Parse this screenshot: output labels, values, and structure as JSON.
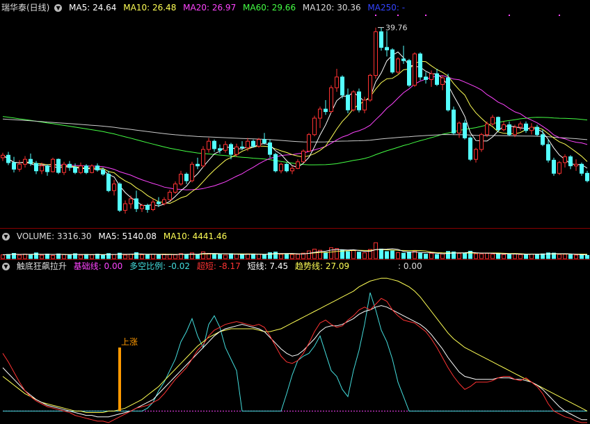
{
  "main_panel": {
    "title": "瑞华泰(日线)",
    "indicators": [
      {
        "label": "MA5: 24.64",
        "color": "#ffffff"
      },
      {
        "label": "MA10: 26.48",
        "color": "#ffff55"
      },
      {
        "label": "MA20: 26.97",
        "color": "#ff44ff"
      },
      {
        "label": "MA60: 29.66",
        "color": "#44ff44"
      },
      {
        "label": "MA120: 30.36",
        "color": "#dddddd"
      },
      {
        "label": "MA250: -",
        "color": "#3344ff"
      }
    ],
    "high_annotation": "39.76"
  },
  "volume_panel": {
    "indicators": [
      {
        "label": "VOLUME: 3316.30",
        "color": "#dddddd"
      },
      {
        "label": "MA5: 5140.08",
        "color": "#ffffff"
      },
      {
        "label": "MA10: 4441.46",
        "color": "#ffff55"
      }
    ]
  },
  "indicator_panel": {
    "title": "触底狂飙拉升",
    "indicators": [
      {
        "label": "基础线: 0.00",
        "color": "#ff44ff"
      },
      {
        "label": "多空比例: -0.02",
        "color": "#44dddd"
      },
      {
        "label": "超短: -8.17",
        "color": "#ff3333"
      },
      {
        "label": "短线: 7.45",
        "color": "#ffffff"
      },
      {
        "label": "趋势线: 27.09",
        "color": "#ffff55"
      },
      {
        "label": ": 0.00",
        "color": "#dddddd"
      }
    ],
    "signal_label": "上涨"
  },
  "colors": {
    "up": "#ff3232",
    "down": "#54ffff",
    "signal": "#ff9900",
    "ma120": "#cccccc"
  },
  "chart_data": {
    "type": "candlestick",
    "price_range": [
      16.5,
      41.5
    ],
    "high_marker": 39.76,
    "candles": [
      [
        24.2,
        24.8,
        23.8,
        24.5
      ],
      [
        24.5,
        24.9,
        23.3,
        23.6
      ],
      [
        23.6,
        24.3,
        22.4,
        22.8
      ],
      [
        22.8,
        23.9,
        22.5,
        23.4
      ],
      [
        23.4,
        24.4,
        23.0,
        24.0
      ],
      [
        24.0,
        24.7,
        23.2,
        23.5
      ],
      [
        23.5,
        23.8,
        22.2,
        22.6
      ],
      [
        22.6,
        23.6,
        22.2,
        23.2
      ],
      [
        23.2,
        23.4,
        22.0,
        22.5
      ],
      [
        22.5,
        24.2,
        22.4,
        24.0
      ],
      [
        24.0,
        24.1,
        22.2,
        22.4
      ],
      [
        22.4,
        23.7,
        22.1,
        23.4
      ],
      [
        23.4,
        23.8,
        22.6,
        23.0
      ],
      [
        23.0,
        23.5,
        22.2,
        22.4
      ],
      [
        22.4,
        23.6,
        22.2,
        23.2
      ],
      [
        23.2,
        23.4,
        22.2,
        22.4
      ],
      [
        22.4,
        23.4,
        22.3,
        23.2
      ],
      [
        23.2,
        23.5,
        22.5,
        22.7
      ],
      [
        22.7,
        23.0,
        22.0,
        22.2
      ],
      [
        22.2,
        22.6,
        20.0,
        20.2
      ],
      [
        20.2,
        21.5,
        19.6,
        21.0
      ],
      [
        21.0,
        21.2,
        17.6,
        17.8
      ],
      [
        17.8,
        19.0,
        17.4,
        18.6
      ],
      [
        18.6,
        19.6,
        18.0,
        19.2
      ],
      [
        19.2,
        20.2,
        17.6,
        18.0
      ],
      [
        18.0,
        18.6,
        17.6,
        18.4
      ],
      [
        18.4,
        18.6,
        17.5,
        17.9
      ],
      [
        17.9,
        19.2,
        17.7,
        18.8
      ],
      [
        18.8,
        19.4,
        18.2,
        18.6
      ],
      [
        18.6,
        19.4,
        18.4,
        19.1
      ],
      [
        19.1,
        20.3,
        19.0,
        20.0
      ],
      [
        20.0,
        21.3,
        19.8,
        21.0
      ],
      [
        21.0,
        22.6,
        20.8,
        22.2
      ],
      [
        22.2,
        22.4,
        21.0,
        21.4
      ],
      [
        21.4,
        23.7,
        21.2,
        23.4
      ],
      [
        23.4,
        24.2,
        22.8,
        23.2
      ],
      [
        23.2,
        25.6,
        23.0,
        25.2
      ],
      [
        25.2,
        26.6,
        24.8,
        26.2
      ],
      [
        26.2,
        26.4,
        24.9,
        25.3
      ],
      [
        25.3,
        25.8,
        24.7,
        25.1
      ],
      [
        25.1,
        26.2,
        24.8,
        25.8
      ],
      [
        25.8,
        26.0,
        24.0,
        24.6
      ],
      [
        24.6,
        25.9,
        24.3,
        25.5
      ],
      [
        25.5,
        26.2,
        25.1,
        25.4
      ],
      [
        25.4,
        26.6,
        25.0,
        26.2
      ],
      [
        26.2,
        26.4,
        25.4,
        25.6
      ],
      [
        25.6,
        26.6,
        25.4,
        26.4
      ],
      [
        26.4,
        27.2,
        25.8,
        26.0
      ],
      [
        26.0,
        26.4,
        24.2,
        24.6
      ],
      [
        24.6,
        24.8,
        22.4,
        22.6
      ],
      [
        22.6,
        23.6,
        22.3,
        23.4
      ],
      [
        23.4,
        23.6,
        22.4,
        22.6
      ],
      [
        22.6,
        23.2,
        22.2,
        22.9
      ],
      [
        22.9,
        24.0,
        22.8,
        23.7
      ],
      [
        23.7,
        25.2,
        23.6,
        25.0
      ],
      [
        25.0,
        27.2,
        24.9,
        27.0
      ],
      [
        27.0,
        29.3,
        26.8,
        29.0
      ],
      [
        29.0,
        30.4,
        27.8,
        30.1
      ],
      [
        30.1,
        31.2,
        29.4,
        29.8
      ],
      [
        29.8,
        33.0,
        29.6,
        32.7
      ],
      [
        32.7,
        35.0,
        32.2,
        34.0
      ],
      [
        34.0,
        34.2,
        31.4,
        31.8
      ],
      [
        31.8,
        32.6,
        29.6,
        30.0
      ],
      [
        30.0,
        32.4,
        29.8,
        32.2
      ],
      [
        32.2,
        32.6,
        29.7,
        30.0
      ],
      [
        30.0,
        31.6,
        29.6,
        31.2
      ],
      [
        31.2,
        34.4,
        31.0,
        34.2
      ],
      [
        34.2,
        40.0,
        33.8,
        39.5
      ],
      [
        39.5,
        40.0,
        37.2,
        37.6
      ],
      [
        37.6,
        39.6,
        36.5,
        37.3
      ],
      [
        37.3,
        37.5,
        34.4,
        34.6
      ],
      [
        34.6,
        36.4,
        34.4,
        36.2
      ],
      [
        36.2,
        37.8,
        35.6,
        36.0
      ],
      [
        36.0,
        36.2,
        32.8,
        33.0
      ],
      [
        33.0,
        37.0,
        32.8,
        36.8
      ],
      [
        36.8,
        37.0,
        33.6,
        34.0
      ],
      [
        34.0,
        34.6,
        33.2,
        33.7
      ],
      [
        33.7,
        34.8,
        32.8,
        34.4
      ],
      [
        34.4,
        35.0,
        32.9,
        33.1
      ],
      [
        33.1,
        34.2,
        32.4,
        33.9
      ],
      [
        33.9,
        34.4,
        29.8,
        30.0
      ],
      [
        30.0,
        30.4,
        27.0,
        27.2
      ],
      [
        27.2,
        28.6,
        26.6,
        28.4
      ],
      [
        28.4,
        28.8,
        26.4,
        26.6
      ],
      [
        26.6,
        26.8,
        23.8,
        24.0
      ],
      [
        24.0,
        25.4,
        23.6,
        25.2
      ],
      [
        25.2,
        27.2,
        24.9,
        27.0
      ],
      [
        27.0,
        28.6,
        26.7,
        28.3
      ],
      [
        28.3,
        29.4,
        28.1,
        29.1
      ],
      [
        29.1,
        29.2,
        27.3,
        27.6
      ],
      [
        27.6,
        28.6,
        27.4,
        28.2
      ],
      [
        28.2,
        28.6,
        26.8,
        27.0
      ],
      [
        27.0,
        28.2,
        26.7,
        27.9
      ],
      [
        27.9,
        28.6,
        27.5,
        28.3
      ],
      [
        28.3,
        28.6,
        27.2,
        27.5
      ],
      [
        27.5,
        28.4,
        27.0,
        27.9
      ],
      [
        27.9,
        28.2,
        26.8,
        27.0
      ],
      [
        27.0,
        27.6,
        25.6,
        25.8
      ],
      [
        25.8,
        26.4,
        23.6,
        23.9
      ],
      [
        23.9,
        24.2,
        22.0,
        22.3
      ],
      [
        22.3,
        23.8,
        22.1,
        23.6
      ],
      [
        23.6,
        24.6,
        23.0,
        24.3
      ],
      [
        24.3,
        24.5,
        22.8,
        23.2
      ],
      [
        23.2,
        24.0,
        22.6,
        23.4
      ],
      [
        23.4,
        23.6,
        22.0,
        22.3
      ],
      [
        22.3,
        22.6,
        21.2,
        21.4
      ]
    ],
    "volume_range": [
      0,
      18000
    ],
    "volume": [
      3900,
      4300,
      5400,
      3600,
      4600,
      3900,
      5900,
      3500,
      4700,
      3300,
      4800,
      4200,
      3700,
      5100,
      3600,
      4400,
      3900,
      4600,
      3400,
      5200,
      4100,
      5600,
      3700,
      4500,
      6200,
      3900,
      3600,
      4400,
      3600,
      4700,
      4400,
      3900,
      5200,
      4100,
      5900,
      3700,
      6900,
      5400,
      4900,
      4500,
      3600,
      5100,
      4600,
      3900,
      4900,
      4300,
      4700,
      3900,
      6100,
      6800,
      4400,
      5100,
      4200,
      4400,
      5600,
      7900,
      9800,
      8600,
      6400,
      11200,
      10400,
      9100,
      7200,
      8300,
      6700,
      6000,
      9400,
      16400,
      9900,
      7300,
      7900,
      6100,
      5600,
      6900,
      7900,
      5600,
      4600,
      5300,
      4300,
      4900,
      7400,
      6900,
      5300,
      5700,
      7600,
      4900,
      4900,
      5300,
      4600,
      5300,
      4200,
      4700,
      4600,
      4100,
      4400,
      4700,
      4500,
      4900,
      5900,
      5700,
      4300,
      4500,
      3900,
      3600,
      3800,
      3300
    ],
    "indicator_range": [
      -8,
      95
    ],
    "signal_index": 21,
    "signal_value": 44,
    "series": {
      "超短": [
        40,
        34,
        27,
        20,
        14,
        10,
        7,
        5,
        3,
        2,
        1,
        0,
        -1,
        -3,
        -4,
        -5,
        -6,
        -7,
        -7,
        -8,
        -6,
        -4,
        -2,
        0,
        2,
        3,
        4,
        6,
        8,
        12,
        17,
        22,
        26,
        30,
        36,
        42,
        46,
        52,
        56,
        58,
        60,
        61,
        62,
        61,
        60,
        59,
        60,
        58,
        52,
        45,
        38,
        34,
        33,
        35,
        40,
        47,
        55,
        61,
        63,
        60,
        58,
        59,
        63,
        66,
        70,
        72,
        70,
        74,
        78,
        76,
        70,
        66,
        63,
        62,
        61,
        58,
        55,
        50,
        44,
        37,
        30,
        24,
        19,
        15,
        17,
        20,
        20,
        20,
        21,
        23,
        24,
        24,
        22,
        21,
        23,
        20,
        17,
        12,
        5,
        0,
        -2,
        -4,
        -5,
        -7,
        -8,
        -8
      ],
      "短线": [
        30,
        26,
        22,
        18,
        14,
        11,
        8,
        6,
        4,
        3,
        2,
        1,
        0,
        -1,
        -2,
        -3,
        -3,
        -4,
        -4,
        -4,
        -3,
        -2,
        -1,
        0,
        2,
        4,
        6,
        8,
        12,
        16,
        20,
        24,
        28,
        32,
        36,
        40,
        44,
        48,
        52,
        55,
        57,
        58,
        59,
        60,
        59,
        58,
        57,
        55,
        51,
        47,
        43,
        40,
        38,
        39,
        42,
        46,
        50,
        55,
        58,
        59,
        59,
        60,
        62,
        64,
        67,
        69,
        70,
        72,
        73,
        72,
        70,
        68,
        66,
        64,
        62,
        60,
        57,
        53,
        48,
        43,
        37,
        32,
        27,
        24,
        23,
        22,
        22,
        22,
        22,
        23,
        23,
        23,
        22,
        22,
        21,
        20,
        18,
        15,
        11,
        7,
        3,
        0,
        -2,
        -4,
        -6,
        -6
      ],
      "趋势线": [
        24,
        21,
        18,
        15,
        12,
        10,
        8,
        6,
        5,
        4,
        3,
        2,
        1,
        0,
        0,
        -1,
        -1,
        -1,
        -1,
        0,
        0,
        1,
        2,
        4,
        6,
        8,
        11,
        14,
        17,
        21,
        25,
        29,
        33,
        37,
        41,
        45,
        48,
        51,
        53,
        55,
        56,
        57,
        57,
        57,
        57,
        57,
        56,
        55,
        55,
        56,
        57,
        59,
        61,
        63,
        65,
        67,
        69,
        71,
        73,
        75,
        77,
        79,
        81,
        83,
        86,
        88,
        90,
        91,
        92,
        92,
        91,
        90,
        88,
        86,
        83,
        79,
        74,
        69,
        64,
        59,
        54,
        50,
        47,
        44,
        42,
        40,
        38,
        36,
        34,
        32,
        30,
        28,
        26,
        24,
        22,
        20,
        18,
        16,
        14,
        12,
        10,
        8,
        6,
        4,
        2,
        0
      ],
      "多空比例": [
        0,
        0,
        0,
        0,
        0,
        0,
        0,
        0,
        0,
        0,
        0,
        0,
        0,
        0,
        0,
        0,
        0,
        0,
        0,
        0,
        0,
        0,
        0,
        0,
        0,
        0,
        2,
        6,
        14,
        20,
        28,
        36,
        48,
        55,
        64,
        52,
        44,
        60,
        66,
        58,
        44,
        36,
        28,
        0,
        0,
        0,
        0,
        0,
        0,
        0,
        0,
        12,
        25,
        35,
        38,
        40,
        45,
        52,
        40,
        28,
        24,
        15,
        10,
        28,
        42,
        60,
        82,
        70,
        56,
        48,
        36,
        20,
        10,
        0,
        0,
        0,
        0,
        0,
        0,
        0,
        0,
        0,
        0,
        0,
        0,
        0,
        0,
        0,
        0,
        0,
        0,
        0,
        0,
        0,
        0,
        0,
        0,
        0,
        0,
        0,
        0,
        0,
        0,
        0,
        0,
        0
      ],
      "基础线": [
        0,
        0,
        0,
        0,
        0,
        0,
        0,
        0,
        0,
        0,
        0,
        0,
        0,
        0,
        0,
        0,
        0,
        0,
        0,
        0,
        0,
        0,
        0,
        0,
        0,
        0,
        0,
        0,
        0,
        0,
        0,
        0,
        0,
        0,
        0,
        0,
        0,
        0,
        0,
        0,
        0,
        0,
        0,
        0,
        0,
        0,
        0,
        0,
        0,
        0,
        0,
        0,
        0,
        0,
        0,
        0,
        0,
        0,
        0,
        0,
        0,
        0,
        0,
        0,
        0,
        0,
        0,
        0,
        0,
        0,
        0,
        0,
        0,
        0,
        0,
        0,
        0,
        0,
        0,
        0,
        0,
        0,
        0,
        0,
        0,
        0,
        0,
        0,
        0,
        0,
        0,
        0,
        0,
        0,
        0,
        0,
        0,
        0,
        0,
        0,
        0,
        0,
        0,
        0,
        0,
        0
      ]
    }
  }
}
